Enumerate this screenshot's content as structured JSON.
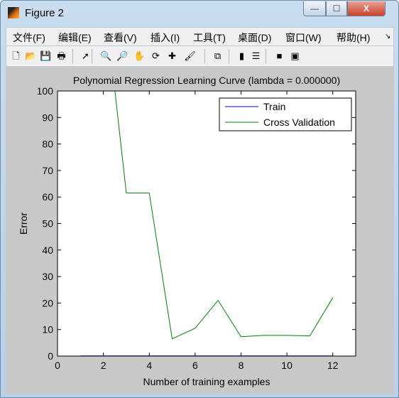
{
  "window": {
    "title": "Figure 2",
    "controls": {
      "minimize": "—",
      "maximize": "☐",
      "close": "X"
    }
  },
  "menu": [
    "文件(F)",
    "编辑(E)",
    "查看(V)",
    "插入(I)",
    "工具(T)",
    "桌面(D)",
    "窗口(W)",
    "帮助(H)"
  ],
  "menu_overflow": "↘",
  "toolbar": [
    {
      "name": "new-figure-icon",
      "glyph": "🗋"
    },
    {
      "name": "open-file-icon",
      "glyph": "📂"
    },
    {
      "name": "save-icon",
      "glyph": "💾"
    },
    {
      "name": "print-icon",
      "glyph": "🖶"
    },
    {
      "name": "edit-plot-arrow-icon",
      "glyph": "➚"
    },
    {
      "name": "zoom-in-icon",
      "glyph": "🔍"
    },
    {
      "name": "zoom-out-icon",
      "glyph": "🔎"
    },
    {
      "name": "pan-hand-icon",
      "glyph": "✋"
    },
    {
      "name": "rotate-3d-icon",
      "glyph": "⟳"
    },
    {
      "name": "data-cursor-icon",
      "glyph": "✚"
    },
    {
      "name": "brush-icon",
      "glyph": "🖌"
    },
    {
      "name": "link-plot-icon",
      "glyph": "⧉"
    },
    {
      "name": "colorbar-icon",
      "glyph": "▮"
    },
    {
      "name": "legend-icon",
      "glyph": "☰"
    },
    {
      "name": "hide-plot-tools-icon",
      "glyph": "■"
    },
    {
      "name": "show-plot-tools-icon",
      "glyph": "▣"
    }
  ],
  "colors": {
    "train": "#0000ff",
    "cv": "#008000",
    "figure_bg": "#c8c8c8"
  },
  "chart_data": {
    "type": "line",
    "title": "Polynomial Regression Learning Curve (lambda = 0.000000)",
    "xlabel": "Number of training examples",
    "ylabel": "Error",
    "xlim": [
      0,
      13
    ],
    "ylim": [
      0,
      100
    ],
    "xticks": [
      0,
      2,
      4,
      6,
      8,
      10,
      12
    ],
    "yticks": [
      0,
      10,
      20,
      30,
      40,
      50,
      60,
      70,
      80,
      90,
      100
    ],
    "grid": false,
    "legend_position": "top-right",
    "series": [
      {
        "name": "Train",
        "x": [
          1,
          2,
          3,
          4,
          5,
          6,
          7,
          8,
          9,
          10,
          11,
          12
        ],
        "y": [
          0,
          0,
          0,
          0,
          0,
          0,
          0,
          0,
          0,
          0,
          0,
          0
        ]
      },
      {
        "name": "Cross Validation",
        "x": [
          2,
          3,
          4,
          5,
          6,
          7,
          8,
          9,
          10,
          11,
          12
        ],
        "y": [
          139,
          61.5,
          61.5,
          6.5,
          10.5,
          21,
          7.3,
          7.8,
          7.8,
          7.6,
          22
        ]
      }
    ]
  }
}
